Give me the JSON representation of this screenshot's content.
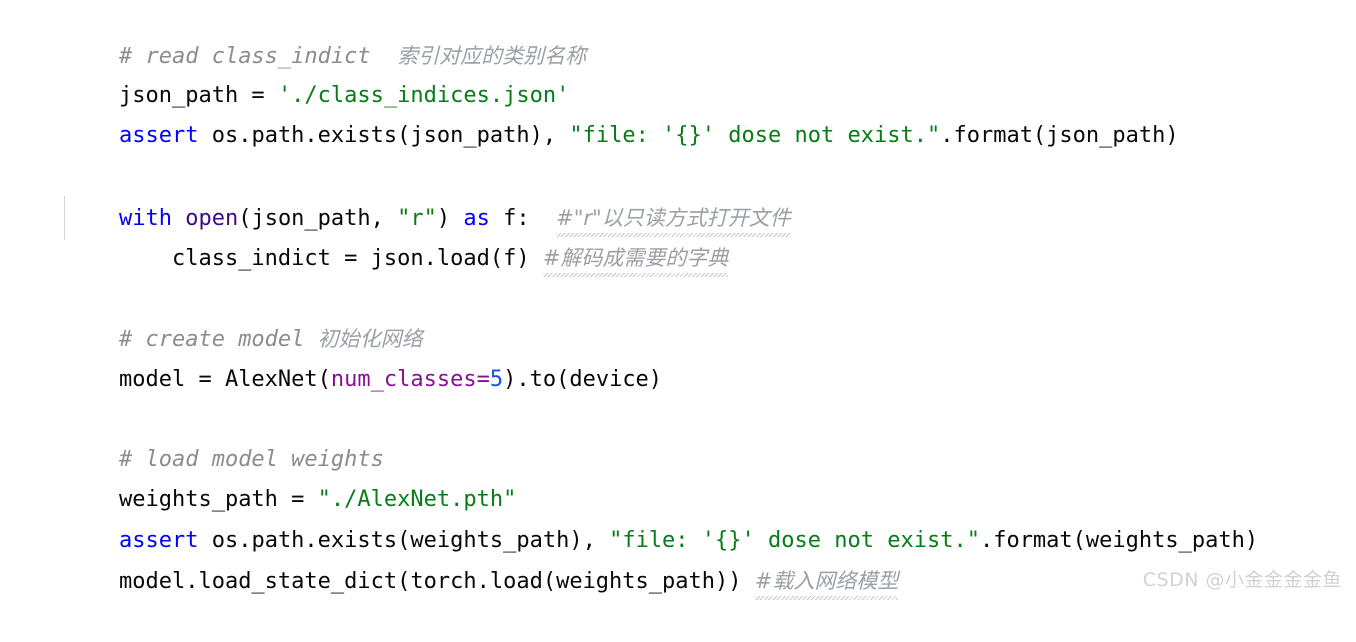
{
  "editor": {
    "language": "Python",
    "background_color": "#ffffff",
    "theme_colors": {
      "keyword": "#0000ff",
      "builtin_function": "#3a0b8c",
      "string": "#067d17",
      "comment": "#8c8c8c",
      "comment_cjk": "#9aa0a6",
      "named_argument": "#871094",
      "number": "#1750eb",
      "default_text": "#080808",
      "indent_guide": "#d5d5d5",
      "squiggle_underline": "#b9bfcc",
      "watermark": "#d2d2d2"
    },
    "lines": [
      {
        "index": 1,
        "type": "comment",
        "tokens": [
          {
            "kind": "comment-en",
            "text": "# read class_indict  "
          },
          {
            "kind": "comment-cn",
            "text": "索引对应的类别名称"
          }
        ]
      },
      {
        "index": 2,
        "type": "code",
        "tokens": [
          {
            "kind": "plain",
            "text": "json_path = "
          },
          {
            "kind": "string",
            "text": "'./class_indices.json'"
          }
        ]
      },
      {
        "index": 3,
        "type": "code",
        "tokens": [
          {
            "kind": "keyword",
            "text": "assert"
          },
          {
            "kind": "plain",
            "text": " os.path.exists(json_path), "
          },
          {
            "kind": "string",
            "text": "\"file: '{}' dose not exist.\""
          },
          {
            "kind": "plain",
            "text": ".format(json_path)"
          }
        ]
      },
      {
        "index": 4,
        "type": "blank",
        "tokens": []
      },
      {
        "index": 5,
        "type": "code",
        "tokens": [
          {
            "kind": "keyword",
            "text": "with"
          },
          {
            "kind": "plain",
            "text": " "
          },
          {
            "kind": "builtin",
            "text": "open"
          },
          {
            "kind": "plain",
            "text": "(json_path, "
          },
          {
            "kind": "string",
            "text": "\"r\""
          },
          {
            "kind": "plain",
            "text": ") "
          },
          {
            "kind": "keyword",
            "text": "as"
          },
          {
            "kind": "plain",
            "text": " f:  "
          },
          {
            "kind": "comment-cn-squiggle",
            "text": "#\"r\"以只读方式打开文件"
          }
        ]
      },
      {
        "index": 6,
        "type": "code-indented",
        "tokens": [
          {
            "kind": "plain",
            "text": "    class_indict = json.load(f) "
          },
          {
            "kind": "comment-cn-squiggle",
            "text": "#解码成需要的字典"
          }
        ]
      },
      {
        "index": 7,
        "type": "blank",
        "tokens": []
      },
      {
        "index": 8,
        "type": "comment",
        "tokens": [
          {
            "kind": "comment-en",
            "text": "# create model "
          },
          {
            "kind": "comment-cn",
            "text": "初始化网络"
          }
        ]
      },
      {
        "index": 9,
        "type": "code",
        "tokens": [
          {
            "kind": "plain",
            "text": "model = AlexNet("
          },
          {
            "kind": "param",
            "text": "num_classes"
          },
          {
            "kind": "operator-param",
            "text": "="
          },
          {
            "kind": "number",
            "text": "5"
          },
          {
            "kind": "plain",
            "text": ").to(device)"
          }
        ]
      },
      {
        "index": 10,
        "type": "blank",
        "tokens": []
      },
      {
        "index": 11,
        "type": "comment",
        "tokens": [
          {
            "kind": "comment-en",
            "text": "# load model weights"
          }
        ]
      },
      {
        "index": 12,
        "type": "code",
        "tokens": [
          {
            "kind": "plain",
            "text": "weights_path = "
          },
          {
            "kind": "string",
            "text": "\"./AlexNet.pth\""
          }
        ]
      },
      {
        "index": 13,
        "type": "code",
        "tokens": [
          {
            "kind": "keyword",
            "text": "assert"
          },
          {
            "kind": "plain",
            "text": " os.path.exists(weights_path), "
          },
          {
            "kind": "string",
            "text": "\"file: '{}' dose not exist.\""
          },
          {
            "kind": "plain",
            "text": ".format(weights_path)"
          }
        ]
      },
      {
        "index": 14,
        "type": "code",
        "tokens": [
          {
            "kind": "plain",
            "text": "model.load_state_dict(torch.load(weights_path)) "
          },
          {
            "kind": "comment-cn-squiggle",
            "text": "#载入网络模型"
          }
        ]
      }
    ]
  },
  "watermark": {
    "text": "CSDN @小金金金金鱼"
  }
}
